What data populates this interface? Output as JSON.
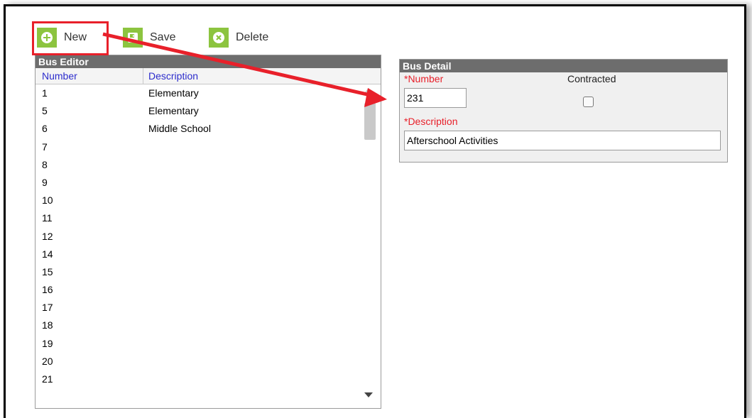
{
  "toolbar": {
    "new_label": "New",
    "save_label": "Save",
    "delete_label": "Delete"
  },
  "bus_editor": {
    "title": "Bus Editor",
    "columns": [
      "Number",
      "Description"
    ],
    "rows": [
      {
        "number": "1",
        "description": "Elementary"
      },
      {
        "number": "5",
        "description": "Elementary"
      },
      {
        "number": "6",
        "description": "Middle School"
      },
      {
        "number": "7",
        "description": ""
      },
      {
        "number": "8",
        "description": ""
      },
      {
        "number": "9",
        "description": ""
      },
      {
        "number": "10",
        "description": ""
      },
      {
        "number": "11",
        "description": ""
      },
      {
        "number": "12",
        "description": ""
      },
      {
        "number": "14",
        "description": ""
      },
      {
        "number": "15",
        "description": ""
      },
      {
        "number": "16",
        "description": ""
      },
      {
        "number": "17",
        "description": ""
      },
      {
        "number": "18",
        "description": ""
      },
      {
        "number": "19",
        "description": ""
      },
      {
        "number": "20",
        "description": ""
      },
      {
        "number": "21",
        "description": ""
      }
    ]
  },
  "bus_detail": {
    "title": "Bus Detail",
    "number_label": "*Number",
    "number_value": "231",
    "contracted_label": "Contracted",
    "contracted_checked": false,
    "description_label": "*Description",
    "description_value": "Afterschool Activities"
  },
  "colors": {
    "accent_green": "#8cc43f",
    "highlight_red": "#e8202a",
    "header_gray": "#6d6d6d",
    "link_blue": "#2c2ccc"
  },
  "icons": [
    "plus-circle-icon",
    "save-icon",
    "delete-x-icon",
    "scroll-up-icon",
    "scroll-down-icon"
  ]
}
